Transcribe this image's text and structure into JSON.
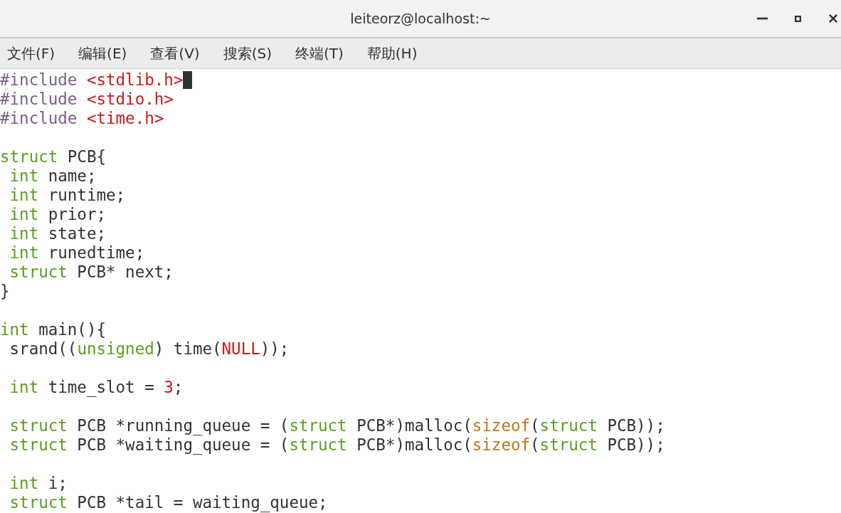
{
  "window": {
    "title": "leiteorz@localhost:~"
  },
  "menu": [
    "文件(F)",
    "编辑(E)",
    "查看(V)",
    "搜索(S)",
    "终端(T)",
    "帮助(H)"
  ],
  "lines": [
    {
      "cursor": true,
      "tokens": [
        {
          "t": "#include ",
          "kind": "pre"
        },
        {
          "t": "<stdlib.h>",
          "kind": "str"
        }
      ]
    },
    {
      "cursor": false,
      "tokens": [
        {
          "t": "#include ",
          "kind": "pre"
        },
        {
          "t": "<stdio.h>",
          "kind": "str"
        }
      ]
    },
    {
      "cursor": false,
      "tokens": [
        {
          "t": "#include ",
          "kind": "pre"
        },
        {
          "t": "<time.h>",
          "kind": "str"
        }
      ]
    },
    {
      "cursor": false
    },
    {
      "cursor": false,
      "tokens": [
        {
          "t": "struct",
          "kind": "type"
        },
        {
          "t": " PCB{",
          "kind": "plain"
        }
      ]
    },
    {
      "cursor": false,
      "tokens": [
        {
          "t": " int",
          "kind": "type"
        },
        {
          "t": " name;",
          "kind": "plain"
        }
      ]
    },
    {
      "cursor": false,
      "tokens": [
        {
          "t": " int",
          "kind": "type"
        },
        {
          "t": " runtime;",
          "kind": "plain"
        }
      ]
    },
    {
      "cursor": false,
      "tokens": [
        {
          "t": " int",
          "kind": "type"
        },
        {
          "t": " prior;",
          "kind": "plain"
        }
      ]
    },
    {
      "cursor": false,
      "tokens": [
        {
          "t": " int",
          "kind": "type"
        },
        {
          "t": " state;",
          "kind": "plain"
        }
      ]
    },
    {
      "cursor": false,
      "tokens": [
        {
          "t": " int",
          "kind": "type"
        },
        {
          "t": " runedtime;",
          "kind": "plain"
        }
      ]
    },
    {
      "cursor": false,
      "tokens": [
        {
          "t": " struct",
          "kind": "type"
        },
        {
          "t": " PCB* next;",
          "kind": "plain"
        }
      ]
    },
    {
      "cursor": false,
      "tokens": [
        {
          "t": "}",
          "kind": "plain"
        }
      ]
    },
    {
      "cursor": false
    },
    {
      "cursor": false,
      "tokens": [
        {
          "t": "int",
          "kind": "type"
        },
        {
          "t": " main(){",
          "kind": "plain"
        }
      ]
    },
    {
      "cursor": false,
      "tokens": [
        {
          "t": " srand((",
          "kind": "plain"
        },
        {
          "t": "unsigned",
          "kind": "type"
        },
        {
          "t": ") time(",
          "kind": "plain"
        },
        {
          "t": "NULL",
          "kind": "const"
        },
        {
          "t": "));",
          "kind": "plain"
        }
      ]
    },
    {
      "cursor": false
    },
    {
      "cursor": false,
      "tokens": [
        {
          "t": " int",
          "kind": "type"
        },
        {
          "t": " time_slot = ",
          "kind": "plain"
        },
        {
          "t": "3",
          "kind": "num"
        },
        {
          "t": ";",
          "kind": "plain"
        }
      ]
    },
    {
      "cursor": false
    },
    {
      "cursor": false,
      "tokens": [
        {
          "t": " struct",
          "kind": "type"
        },
        {
          "t": " PCB *running_queue = (",
          "kind": "plain"
        },
        {
          "t": "struct",
          "kind": "type"
        },
        {
          "t": " PCB*)malloc(",
          "kind": "plain"
        },
        {
          "t": "sizeof",
          "kind": "op"
        },
        {
          "t": "(",
          "kind": "plain"
        },
        {
          "t": "struct",
          "kind": "type"
        },
        {
          "t": " PCB));",
          "kind": "plain"
        }
      ]
    },
    {
      "cursor": false,
      "tokens": [
        {
          "t": " struct",
          "kind": "type"
        },
        {
          "t": " PCB *waiting_queue = (",
          "kind": "plain"
        },
        {
          "t": "struct",
          "kind": "type"
        },
        {
          "t": " PCB*)malloc(",
          "kind": "plain"
        },
        {
          "t": "sizeof",
          "kind": "op"
        },
        {
          "t": "(",
          "kind": "plain"
        },
        {
          "t": "struct",
          "kind": "type"
        },
        {
          "t": " PCB));",
          "kind": "plain"
        }
      ]
    },
    {
      "cursor": false
    },
    {
      "cursor": false,
      "tokens": [
        {
          "t": " int",
          "kind": "type"
        },
        {
          "t": " i;",
          "kind": "plain"
        }
      ]
    },
    {
      "cursor": false,
      "tokens": [
        {
          "t": " struct",
          "kind": "type"
        },
        {
          "t": " PCB *tail = waiting_queue;",
          "kind": "plain"
        }
      ]
    }
  ]
}
